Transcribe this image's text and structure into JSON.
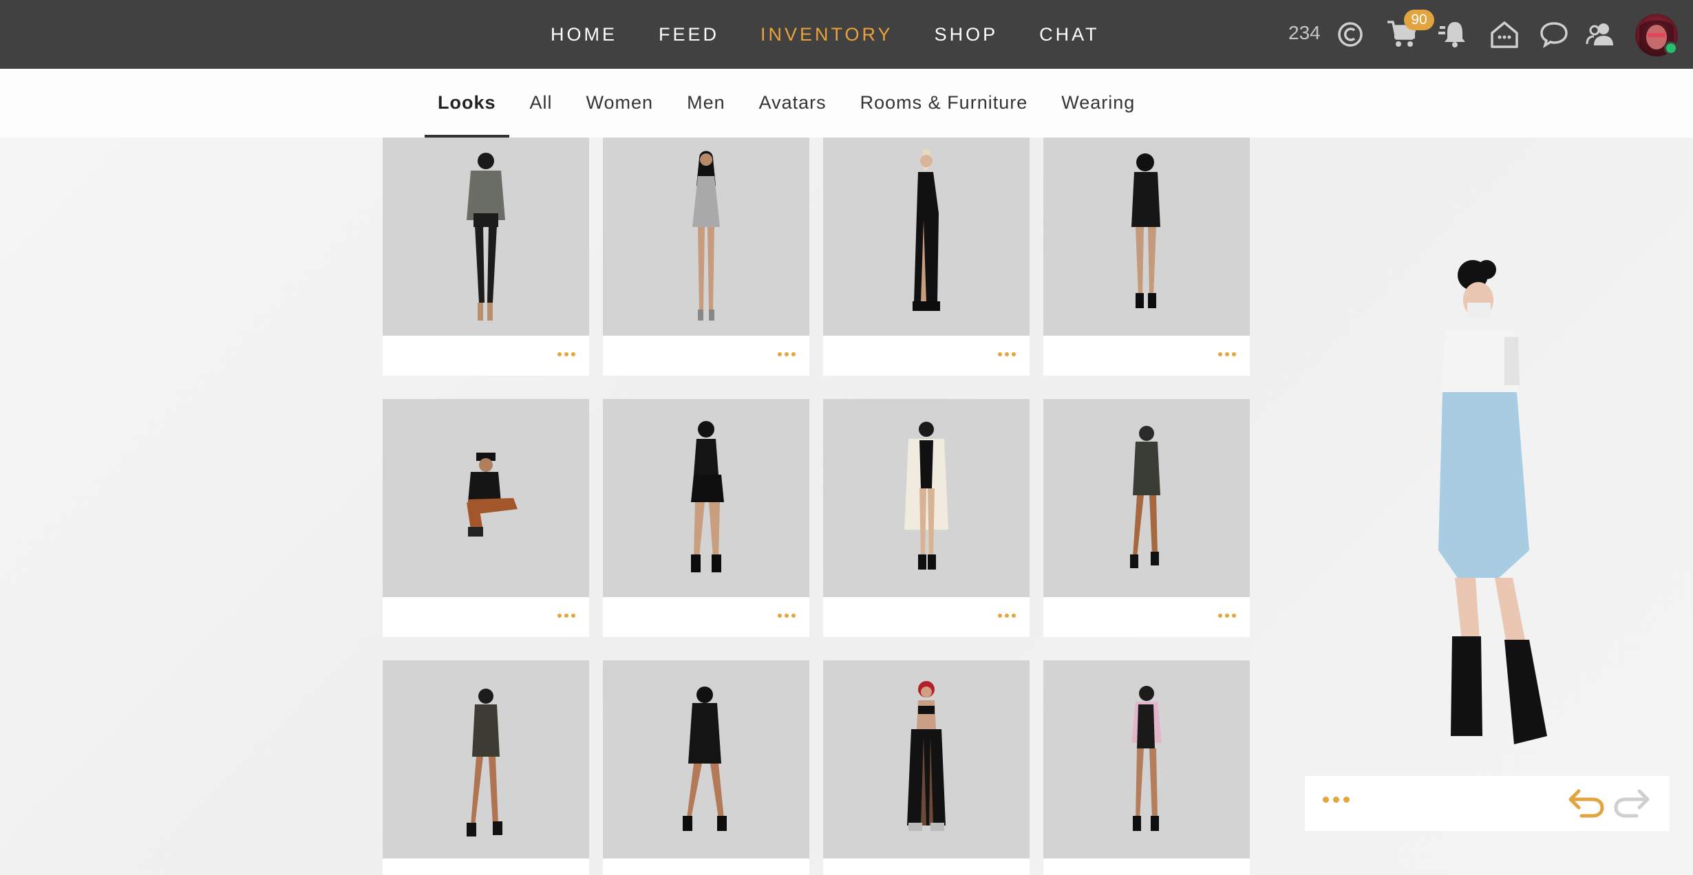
{
  "nav": {
    "items": [
      {
        "label": "HOME",
        "active": false
      },
      {
        "label": "FEED",
        "active": false
      },
      {
        "label": "INVENTORY",
        "active": true
      },
      {
        "label": "SHOP",
        "active": false
      },
      {
        "label": "CHAT",
        "active": false
      }
    ],
    "credits": "234",
    "cart_badge": "90",
    "accent_color": "#e9a33c",
    "bar_color": "#414141",
    "icons": [
      "credits-icon",
      "cart-icon",
      "notifications-icon",
      "home-icon",
      "chat-bubble-icon",
      "friends-icon"
    ]
  },
  "tabs": [
    {
      "label": "Looks",
      "active": true
    },
    {
      "label": "All",
      "active": false
    },
    {
      "label": "Women",
      "active": false
    },
    {
      "label": "Men",
      "active": false
    },
    {
      "label": "Avatars",
      "active": false
    },
    {
      "label": "Rooms & Furniture",
      "active": false
    },
    {
      "label": "Wearing",
      "active": false
    }
  ],
  "looks": [
    {
      "outfit": "puffer-jacket-black-pants"
    },
    {
      "outfit": "grey-mini-dress"
    },
    {
      "outfit": "black-slit-gown"
    },
    {
      "outfit": "black-mini-hoodie"
    },
    {
      "outfit": "sitting-cap-look"
    },
    {
      "outfit": "black-shorts-crop"
    },
    {
      "outfit": "white-coat-bodysuit"
    },
    {
      "outfit": "dark-jacket-shorts"
    },
    {
      "outfit": "camo-jacket-shorts"
    },
    {
      "outfit": "black-hoodie-dress"
    },
    {
      "outfit": "red-hair-wide-pants"
    },
    {
      "outfit": "pink-jacket-shorts"
    }
  ],
  "preview": {
    "outfit": "white-tee-light-denim",
    "actions": [
      "more-options-icon",
      "undo-icon",
      "redo-icon"
    ]
  }
}
